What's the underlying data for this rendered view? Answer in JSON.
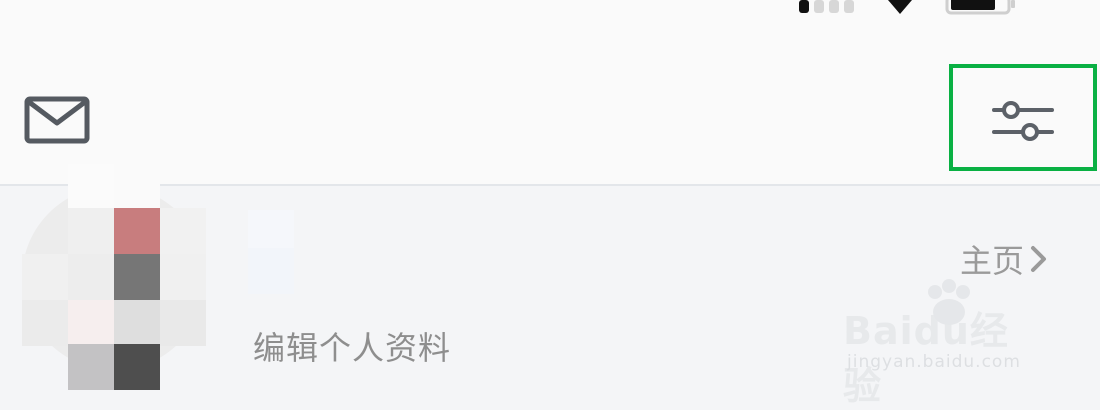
{
  "status_bar": {
    "signal_icon": "signal-bars-icon",
    "wifi_icon": "wifi-icon",
    "battery_icon": "battery-icon"
  },
  "header": {
    "mail_icon": "mail-icon",
    "settings_icon": "sliders-icon",
    "highlight_color": "#09b043"
  },
  "profile": {
    "edit_profile_label": "编辑个人资料",
    "homepage_label": "主页"
  },
  "watermark": {
    "logo_text": "Baidu经验",
    "url_text": "jingyan.baidu.com"
  }
}
